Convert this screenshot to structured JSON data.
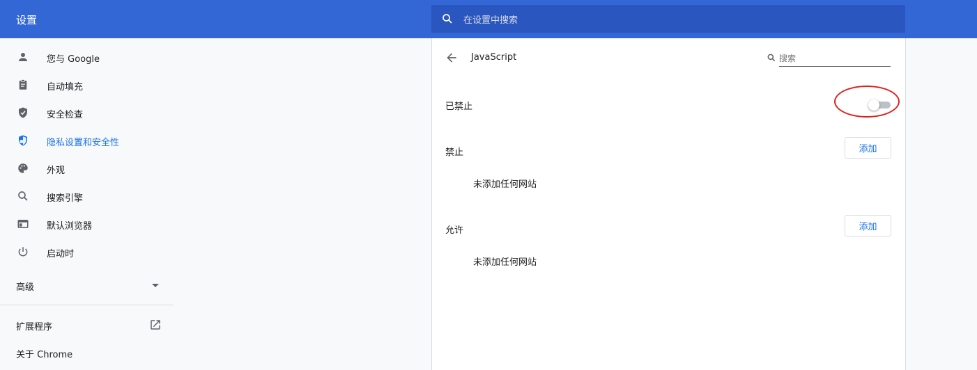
{
  "header": {
    "title": "设置",
    "search_placeholder": "在设置中搜索"
  },
  "sidebar": {
    "items": [
      {
        "label": "您与 Google",
        "icon": "person-icon",
        "active": false
      },
      {
        "label": "自动填充",
        "icon": "clipboard-icon",
        "active": false
      },
      {
        "label": "安全检查",
        "icon": "shield-check-icon",
        "active": false
      },
      {
        "label": "隐私设置和安全性",
        "icon": "privacy-shield-icon",
        "active": true
      },
      {
        "label": "外观",
        "icon": "palette-icon",
        "active": false
      },
      {
        "label": "搜索引擎",
        "icon": "search-icon",
        "active": false
      },
      {
        "label": "默认浏览器",
        "icon": "browser-icon",
        "active": false
      },
      {
        "label": "启动时",
        "icon": "power-icon",
        "active": false
      }
    ],
    "advanced_label": "高级",
    "extensions_label": "扩展程序",
    "about_label": "关于 Chrome"
  },
  "page": {
    "title": "JavaScript",
    "search_placeholder": "搜索",
    "toggle_label": "已禁止",
    "toggle_on": false,
    "block": {
      "label": "禁止",
      "add_label": "添加",
      "empty_text": "未添加任何网站"
    },
    "allow": {
      "label": "允许",
      "add_label": "添加",
      "empty_text": "未添加任何网站"
    }
  },
  "colors": {
    "header_bg": "#3367d6",
    "accent": "#1a73e8",
    "highlight": "#e0201b"
  }
}
